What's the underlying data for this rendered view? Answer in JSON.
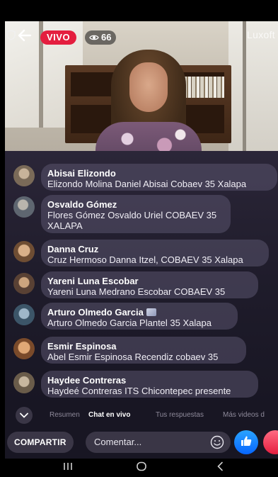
{
  "live": {
    "badge_label": "VIVO",
    "viewer_count": "66",
    "brand_text": "Luxoft"
  },
  "comments": [
    {
      "name": "Abisai Elizondo",
      "message": "Elizondo Molina Daniel Abisai Cobaev 35 Xalapa",
      "has_icon": false
    },
    {
      "name": "Osvaldo Gómez",
      "message": "Flores Gómez Osvaldo Uriel COBAEV 35 XALAPA",
      "has_icon": false
    },
    {
      "name": "Danna Cruz",
      "message": "Cruz Hermoso Danna Itzel, COBAEV 35 Xalapa",
      "has_icon": false
    },
    {
      "name": "Yareni Luna Escobar",
      "message": "Yareni Luna Medrano Escobar COBAEV 35",
      "has_icon": false
    },
    {
      "name": "Arturo Olmedo Garcia",
      "message": "Arturo Olmedo Garcia Plantel 35 Xalapa",
      "has_icon": true
    },
    {
      "name": "Esmir Espinosa",
      "message": "Abel Esmir  Espinosa Recendiz cobaev 35",
      "has_icon": false
    },
    {
      "name": "Haydee Contreras",
      "message": "Haydeé Contreras ITS Chicontepec presente",
      "has_icon": false
    }
  ],
  "tabs": [
    {
      "label": "Resumen",
      "active": false
    },
    {
      "label": "Chat en vivo",
      "active": true
    },
    {
      "label": "Tus respuestas",
      "active": false
    },
    {
      "label": "Más videos d",
      "active": false
    }
  ],
  "bottom": {
    "share_label": "COMPARTIR",
    "comment_placeholder": "Comentar..."
  },
  "colors": {
    "live_red": "#e41e3f",
    "like_blue": "#0866ff",
    "panel_bg": "#1f1c2b"
  },
  "icons": [
    "shield-icon",
    "back-arrow-icon",
    "eye-icon",
    "chevron-down-icon",
    "emoji-icon",
    "thumbs-up-icon",
    "heart-icon",
    "recents-icon",
    "home-icon",
    "nav-back-icon"
  ]
}
